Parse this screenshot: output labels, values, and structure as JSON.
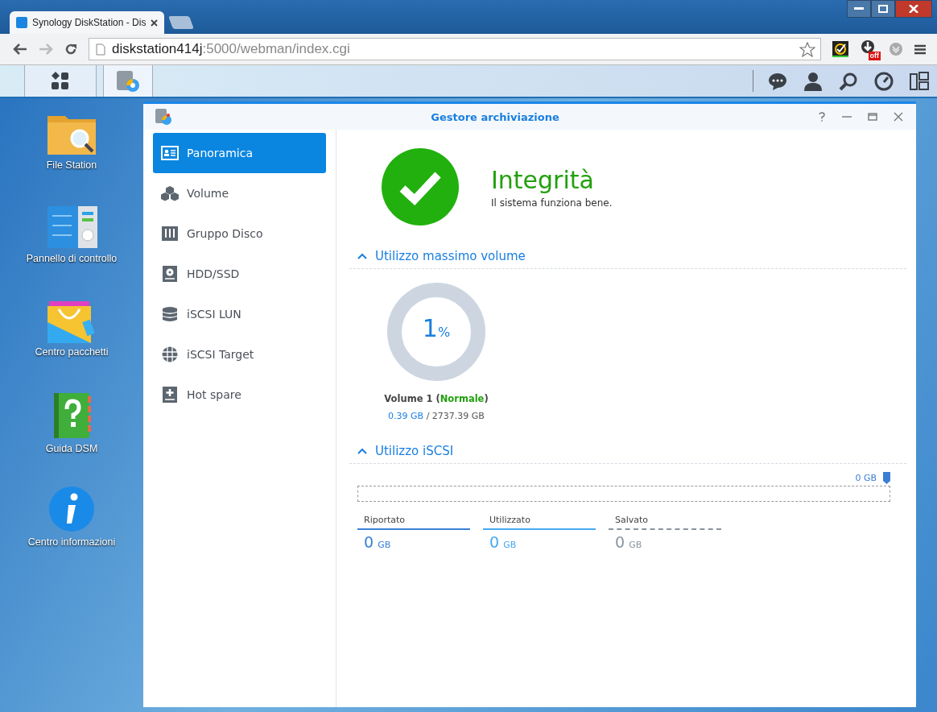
{
  "browser": {
    "tab_title": "Synology DiskStation - Dis",
    "url_host": "diskstation414j",
    "url_path": ":5000/webman/index.cgi",
    "extension_badge": "off"
  },
  "desktop_icons": [
    {
      "label": "File Station",
      "kind": "folder"
    },
    {
      "label": "Pannello di controllo",
      "kind": "panel"
    },
    {
      "label": "Centro pacchetti",
      "kind": "package"
    },
    {
      "label": "Guida DSM",
      "kind": "help"
    },
    {
      "label": "Centro informazioni",
      "kind": "info"
    }
  ],
  "window": {
    "title": "Gestore archiviazione"
  },
  "sidebar": {
    "items": [
      {
        "label": "Panoramica",
        "kind": "overview",
        "selected": true
      },
      {
        "label": "Volume",
        "kind": "cubes",
        "selected": false
      },
      {
        "label": "Gruppo Disco",
        "kind": "group",
        "selected": false
      },
      {
        "label": "HDD/SSD",
        "kind": "disk",
        "selected": false
      },
      {
        "label": "iSCSI LUN",
        "kind": "database",
        "selected": false
      },
      {
        "label": "iSCSI Target",
        "kind": "globe",
        "selected": false
      },
      {
        "label": "Hot spare",
        "kind": "spare",
        "selected": false
      }
    ]
  },
  "health": {
    "title": "Integrità",
    "subtitle": "Il sistema funziona bene."
  },
  "volume_section": {
    "header": "Utilizzo massimo volume",
    "expanded": true,
    "percent": "1",
    "unit": "%",
    "label_prefix": "Volume 1 (",
    "status": "Normale",
    "label_suffix": ")",
    "used": "0.39 GB",
    "separator": "/",
    "total": "2737.39 GB"
  },
  "iscsi_section": {
    "header": "Utilizzo iSCSI",
    "expanded": true,
    "bar_label": "0 GB",
    "legend": [
      {
        "label": "Riportato",
        "value": "0",
        "unit": "GB",
        "color": "#3a7fd4",
        "kind": "solid"
      },
      {
        "label": "Utilizzato",
        "value": "0",
        "unit": "GB",
        "color": "#45a8f0",
        "kind": "solid"
      },
      {
        "label": "Salvato",
        "value": "0",
        "unit": "GB",
        "color": "#8a949e",
        "kind": "dashed"
      }
    ]
  }
}
